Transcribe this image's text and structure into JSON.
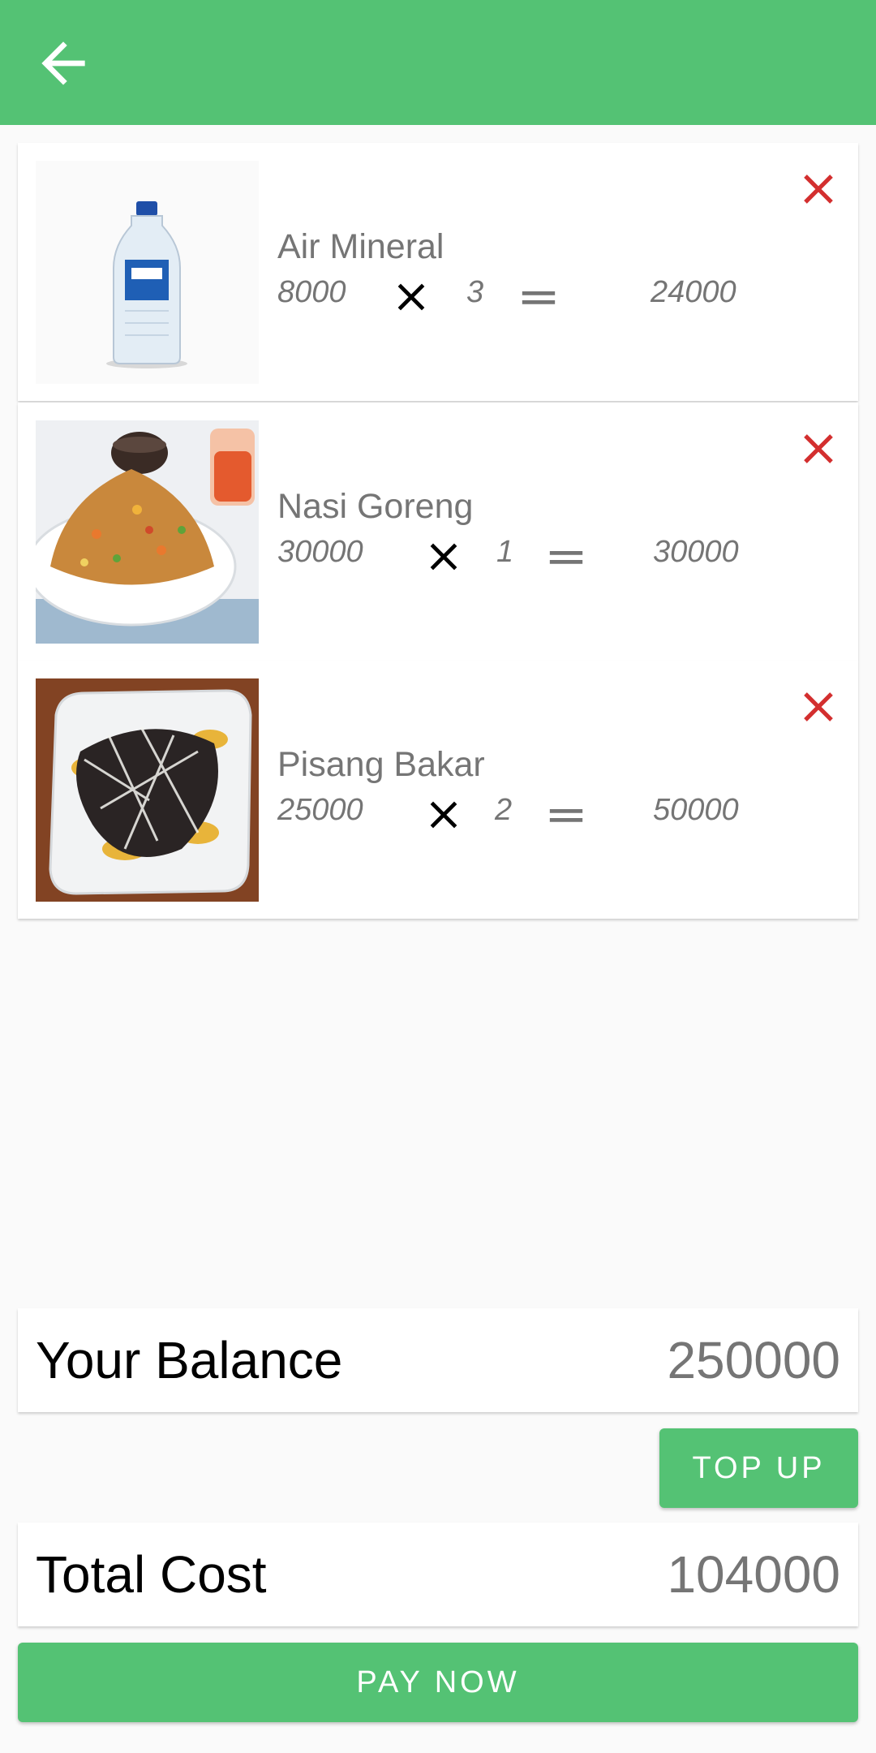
{
  "app_bar": {
    "back_icon": "arrow-back-icon",
    "color": "#54c274"
  },
  "cart_items": [
    {
      "name": "Air Mineral",
      "price": "8000",
      "qty": "3",
      "subtotal": "24000",
      "image": "water-bottle-photo"
    },
    {
      "name": "Nasi Goreng",
      "price": "30000",
      "qty": "1",
      "subtotal": "30000",
      "image": "fried-rice-photo"
    },
    {
      "name": "Pisang Bakar",
      "price": "25000",
      "qty": "2",
      "subtotal": "50000",
      "image": "grilled-banana-photo"
    }
  ],
  "icons": {
    "multiply": "multiply-icon",
    "equals": "equals-icon",
    "remove": "close-icon",
    "remove_color": "#d32f2f"
  },
  "balance": {
    "label": "Your Balance",
    "value": "250000"
  },
  "top_up_label": "TOP UP",
  "total": {
    "label": "Total Cost",
    "value": "104000"
  },
  "pay_label": "PAY NOW"
}
